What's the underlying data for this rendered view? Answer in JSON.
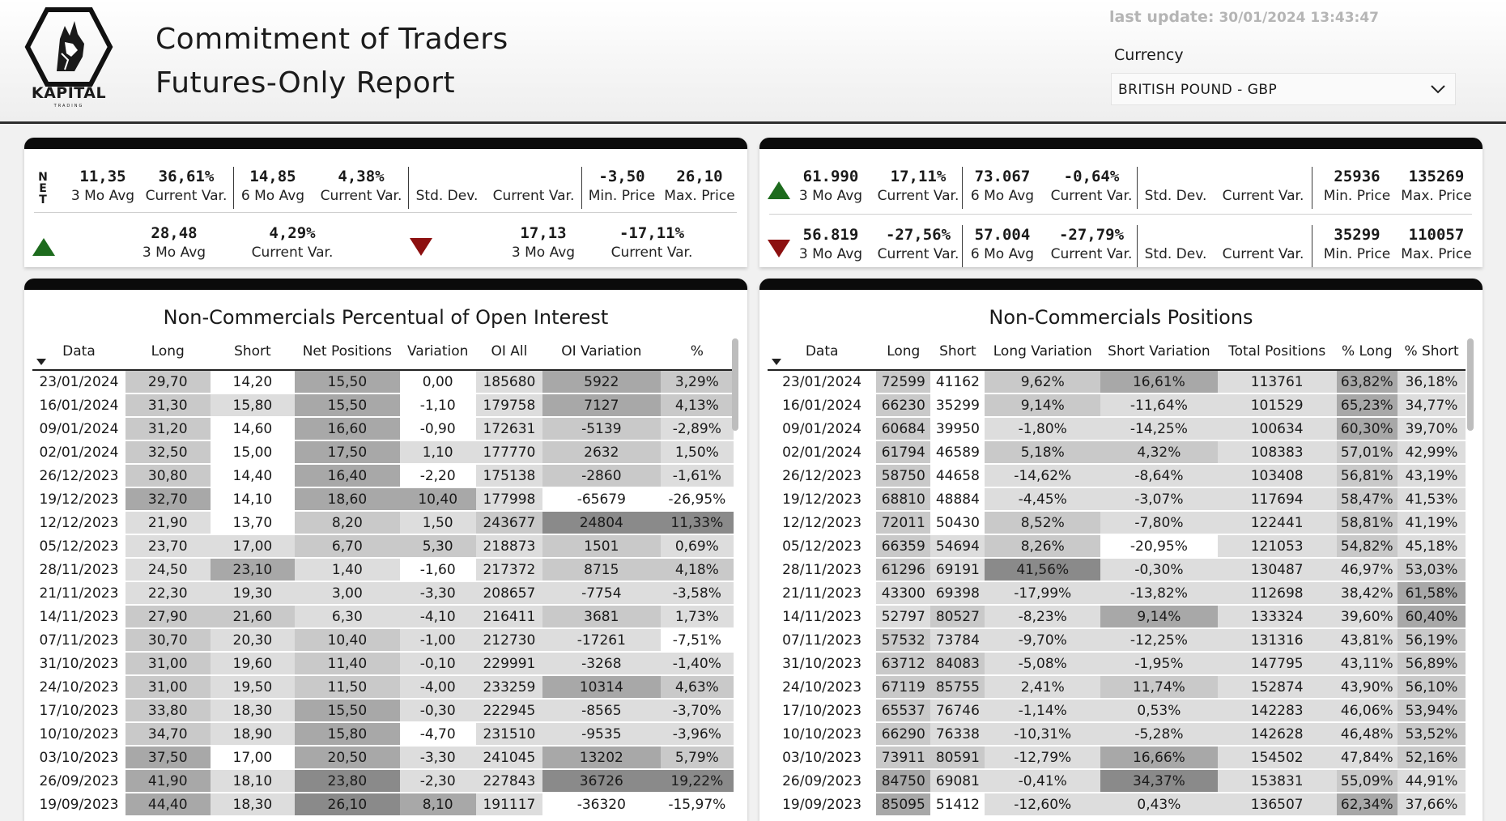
{
  "header": {
    "logo_text": "KAPITAL",
    "logo_sub": "TRADING",
    "title_line1": "Commitment of Traders",
    "title_line2": "Futures-Only Report",
    "last_update_label": "last update:",
    "last_update_value": "30/01/2024 13:43:47",
    "currency_label": "Currency",
    "currency_value": "BRITISH POUND - GBP"
  },
  "stats_left": {
    "net_letters": [
      "N",
      "E",
      "T"
    ],
    "row1": [
      {
        "value": "11,35",
        "label": "3 Mo Avg"
      },
      {
        "value": "36,61%",
        "label": "Current Var."
      },
      {
        "value": "14,85",
        "label": "6 Mo Avg"
      },
      {
        "value": "4,38%",
        "label": "Current Var."
      },
      {
        "value": "",
        "label": "Std. Dev."
      },
      {
        "value": "",
        "label": "Current Var."
      },
      {
        "value": "-3,50",
        "label": "Min. Price"
      },
      {
        "value": "26,10",
        "label": "Max. Price"
      }
    ],
    "row2_up": [
      {
        "value": "28,48",
        "label": "3 Mo Avg"
      },
      {
        "value": "4,29%",
        "label": "Current Var."
      }
    ],
    "row2_down": [
      {
        "value": "17,13",
        "label": "3 Mo Avg"
      },
      {
        "value": "-17,11%",
        "label": "Current Var."
      }
    ]
  },
  "stats_right": {
    "row_up": [
      {
        "value": "61.990",
        "label": "3 Mo Avg"
      },
      {
        "value": "17,11%",
        "label": "Current Var."
      },
      {
        "value": "73.067",
        "label": "6 Mo Avg"
      },
      {
        "value": "-0,64%",
        "label": "Current Var."
      },
      {
        "value": "",
        "label": "Std. Dev."
      },
      {
        "value": "",
        "label": "Current Var."
      },
      {
        "value": "25936",
        "label": "Min. Price"
      },
      {
        "value": "135269",
        "label": "Max. Price"
      }
    ],
    "row_down": [
      {
        "value": "56.819",
        "label": "3 Mo Avg"
      },
      {
        "value": "-27,56%",
        "label": "Current Var."
      },
      {
        "value": "57.004",
        "label": "6 Mo Avg"
      },
      {
        "value": "-27,79%",
        "label": "Current Var."
      },
      {
        "value": "",
        "label": "Std. Dev."
      },
      {
        "value": "",
        "label": "Current Var."
      },
      {
        "value": "35299",
        "label": "Min. Price"
      },
      {
        "value": "110057",
        "label": "Max. Price"
      }
    ]
  },
  "colors": {
    "up_arrow": "#1d6b1d",
    "down_arrow": "#8c1010",
    "cell_dark": "#8a8a8a",
    "cell_mid": "#a8a8a8",
    "cell_light": "#c9c9c9",
    "cell_pale": "#dddddd",
    "cell_white": "#f3f3f3"
  },
  "table_left": {
    "title": "Non-Commercials Percentual of Open Interest",
    "columns": [
      "Data",
      "Long",
      "Short",
      "Net Positions",
      "Variation",
      "OI All",
      "OI Variation",
      "%"
    ],
    "rows": [
      [
        "23/01/2024",
        "29,70",
        "14,20",
        "15,50",
        "0,00",
        "185680",
        "5922",
        "3,29%"
      ],
      [
        "16/01/2024",
        "31,30",
        "15,80",
        "15,50",
        "-1,10",
        "179758",
        "7127",
        "4,13%"
      ],
      [
        "09/01/2024",
        "31,20",
        "14,60",
        "16,60",
        "-0,90",
        "172631",
        "-5139",
        "-2,89%"
      ],
      [
        "02/01/2024",
        "32,50",
        "15,00",
        "17,50",
        "1,10",
        "177770",
        "2632",
        "1,50%"
      ],
      [
        "26/12/2023",
        "30,80",
        "14,40",
        "16,40",
        "-2,20",
        "175138",
        "-2860",
        "-1,61%"
      ],
      [
        "19/12/2023",
        "32,70",
        "14,10",
        "18,60",
        "10,40",
        "177998",
        "-65679",
        "-26,95%"
      ],
      [
        "12/12/2023",
        "21,90",
        "13,70",
        "8,20",
        "1,50",
        "243677",
        "24804",
        "11,33%"
      ],
      [
        "05/12/2023",
        "23,70",
        "17,00",
        "6,70",
        "5,30",
        "218873",
        "1501",
        "0,69%"
      ],
      [
        "28/11/2023",
        "24,50",
        "23,10",
        "1,40",
        "-1,60",
        "217372",
        "8715",
        "4,18%"
      ],
      [
        "21/11/2023",
        "22,30",
        "19,30",
        "3,00",
        "-3,30",
        "208657",
        "-7754",
        "-3,58%"
      ],
      [
        "14/11/2023",
        "27,90",
        "21,60",
        "6,30",
        "-4,10",
        "216411",
        "3681",
        "1,73%"
      ],
      [
        "07/11/2023",
        "30,70",
        "20,30",
        "10,40",
        "-1,00",
        "212730",
        "-17261",
        "-7,51%"
      ],
      [
        "31/10/2023",
        "31,00",
        "19,60",
        "11,40",
        "-0,10",
        "229991",
        "-3268",
        "-1,40%"
      ],
      [
        "24/10/2023",
        "31,00",
        "19,50",
        "11,50",
        "-4,00",
        "233259",
        "10314",
        "4,63%"
      ],
      [
        "17/10/2023",
        "33,80",
        "18,30",
        "15,50",
        "-0,30",
        "222945",
        "-8565",
        "-3,70%"
      ],
      [
        "10/10/2023",
        "34,70",
        "18,90",
        "15,80",
        "-4,70",
        "231510",
        "-9535",
        "-3,96%"
      ],
      [
        "03/10/2023",
        "37,50",
        "17,00",
        "20,50",
        "-3,30",
        "241045",
        "13202",
        "5,79%"
      ],
      [
        "26/09/2023",
        "41,90",
        "18,10",
        "23,80",
        "-2,30",
        "227843",
        "36726",
        "19,22%"
      ],
      [
        "19/09/2023",
        "44,40",
        "18,30",
        "26,10",
        "8,10",
        "191117",
        "-36320",
        "-15,97%"
      ]
    ],
    "shades": [
      [
        0,
        2,
        0,
        3,
        0,
        1,
        3,
        2
      ],
      [
        0,
        2,
        1,
        3,
        0,
        1,
        3,
        2
      ],
      [
        0,
        2,
        0,
        3,
        0,
        1,
        2,
        1
      ],
      [
        0,
        2,
        0,
        3,
        1,
        1,
        2,
        1
      ],
      [
        0,
        2,
        0,
        3,
        0,
        1,
        2,
        1
      ],
      [
        0,
        3,
        0,
        3,
        3,
        1,
        0,
        0
      ],
      [
        0,
        1,
        0,
        2,
        1,
        2,
        4,
        4
      ],
      [
        0,
        1,
        1,
        2,
        2,
        1,
        2,
        1
      ],
      [
        0,
        1,
        3,
        1,
        0,
        1,
        2,
        2
      ],
      [
        0,
        1,
        1,
        1,
        1,
        1,
        1,
        1
      ],
      [
        0,
        2,
        2,
        1,
        1,
        1,
        2,
        1
      ],
      [
        0,
        2,
        1,
        2,
        1,
        1,
        1,
        0
      ],
      [
        0,
        2,
        1,
        2,
        1,
        1,
        1,
        1
      ],
      [
        0,
        2,
        1,
        2,
        1,
        1,
        3,
        2
      ],
      [
        0,
        2,
        1,
        3,
        1,
        1,
        1,
        1
      ],
      [
        0,
        2,
        1,
        3,
        0,
        1,
        1,
        1
      ],
      [
        0,
        3,
        0,
        3,
        1,
        1,
        3,
        2
      ],
      [
        0,
        3,
        1,
        4,
        1,
        1,
        4,
        4
      ],
      [
        0,
        3,
        1,
        4,
        3,
        1,
        0,
        0
      ]
    ]
  },
  "table_right": {
    "title": "Non-Commercials Positions",
    "columns": [
      "Data",
      "Long",
      "Short",
      "Long Variation",
      "Short Variation",
      "Total Positions",
      "% Long",
      "% Short"
    ],
    "rows": [
      [
        "23/01/2024",
        "72599",
        "41162",
        "9,62%",
        "16,61%",
        "113761",
        "63,82%",
        "36,18%"
      ],
      [
        "16/01/2024",
        "66230",
        "35299",
        "9,14%",
        "-11,64%",
        "101529",
        "65,23%",
        "34,77%"
      ],
      [
        "09/01/2024",
        "60684",
        "39950",
        "-1,80%",
        "-14,25%",
        "100634",
        "60,30%",
        "39,70%"
      ],
      [
        "02/01/2024",
        "61794",
        "46589",
        "5,18%",
        "4,32%",
        "108383",
        "57,01%",
        "42,99%"
      ],
      [
        "26/12/2023",
        "58750",
        "44658",
        "-14,62%",
        "-8,64%",
        "103408",
        "56,81%",
        "43,19%"
      ],
      [
        "19/12/2023",
        "68810",
        "48884",
        "-4,45%",
        "-3,07%",
        "117694",
        "58,47%",
        "41,53%"
      ],
      [
        "12/12/2023",
        "72011",
        "50430",
        "8,52%",
        "-7,80%",
        "122441",
        "58,81%",
        "41,19%"
      ],
      [
        "05/12/2023",
        "66359",
        "54694",
        "8,26%",
        "-20,95%",
        "121053",
        "54,82%",
        "45,18%"
      ],
      [
        "28/11/2023",
        "61296",
        "69191",
        "41,56%",
        "-0,30%",
        "130487",
        "46,97%",
        "53,03%"
      ],
      [
        "21/11/2023",
        "43300",
        "69398",
        "-17,99%",
        "-13,82%",
        "112698",
        "38,42%",
        "61,58%"
      ],
      [
        "14/11/2023",
        "52797",
        "80527",
        "-8,23%",
        "9,14%",
        "133324",
        "39,60%",
        "60,40%"
      ],
      [
        "07/11/2023",
        "57532",
        "73784",
        "-9,70%",
        "-12,25%",
        "131316",
        "43,81%",
        "56,19%"
      ],
      [
        "31/10/2023",
        "63712",
        "84083",
        "-5,08%",
        "-1,95%",
        "147795",
        "43,11%",
        "56,89%"
      ],
      [
        "24/10/2023",
        "67119",
        "85755",
        "2,41%",
        "11,74%",
        "152874",
        "43,90%",
        "56,10%"
      ],
      [
        "17/10/2023",
        "65537",
        "76746",
        "-1,14%",
        "0,53%",
        "142283",
        "46,06%",
        "53,94%"
      ],
      [
        "10/10/2023",
        "66290",
        "76338",
        "-10,31%",
        "-5,28%",
        "142628",
        "46,48%",
        "53,52%"
      ],
      [
        "03/10/2023",
        "73911",
        "80591",
        "-12,79%",
        "16,66%",
        "154502",
        "47,84%",
        "52,16%"
      ],
      [
        "26/09/2023",
        "84750",
        "69081",
        "-0,41%",
        "34,37%",
        "153831",
        "55,09%",
        "44,91%"
      ],
      [
        "19/09/2023",
        "85095",
        "51412",
        "-12,60%",
        "0,43%",
        "136507",
        "62,34%",
        "37,66%"
      ]
    ],
    "shades": [
      [
        0,
        2,
        0,
        2,
        3,
        1,
        3,
        1
      ],
      [
        0,
        2,
        0,
        2,
        1,
        1,
        3,
        1
      ],
      [
        0,
        2,
        0,
        1,
        1,
        1,
        3,
        1
      ],
      [
        0,
        2,
        0,
        2,
        2,
        1,
        2,
        1
      ],
      [
        0,
        2,
        0,
        1,
        1,
        1,
        2,
        1
      ],
      [
        0,
        2,
        0,
        1,
        1,
        1,
        2,
        1
      ],
      [
        0,
        2,
        0,
        2,
        1,
        1,
        2,
        1
      ],
      [
        0,
        2,
        1,
        2,
        0,
        1,
        2,
        1
      ],
      [
        0,
        2,
        1,
        4,
        1,
        1,
        1,
        2
      ],
      [
        0,
        1,
        1,
        1,
        1,
        1,
        1,
        3
      ],
      [
        0,
        1,
        2,
        1,
        3,
        1,
        1,
        3
      ],
      [
        0,
        2,
        1,
        1,
        1,
        1,
        1,
        2
      ],
      [
        0,
        2,
        2,
        1,
        1,
        1,
        1,
        2
      ],
      [
        0,
        2,
        2,
        1,
        2,
        1,
        1,
        2
      ],
      [
        0,
        2,
        1,
        1,
        1,
        1,
        1,
        2
      ],
      [
        0,
        2,
        1,
        1,
        1,
        1,
        1,
        2
      ],
      [
        0,
        2,
        2,
        1,
        3,
        1,
        1,
        2
      ],
      [
        0,
        3,
        1,
        1,
        4,
        1,
        2,
        1
      ],
      [
        0,
        3,
        0,
        1,
        1,
        1,
        3,
        1
      ]
    ]
  }
}
